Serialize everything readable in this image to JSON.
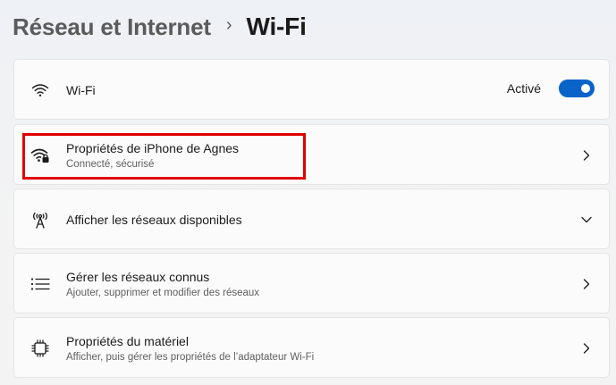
{
  "breadcrumb": {
    "parent": "Réseau et Internet",
    "separator": "›",
    "current": "Wi-Fi"
  },
  "wifi_toggle": {
    "label": "Wi-Fi",
    "state_text": "Activé",
    "on": true,
    "icon": "wifi-icon"
  },
  "items": [
    {
      "label": "Propriétés de iPhone de Agnes",
      "sub": "Connecté, sécurisé",
      "icon": "wifi-secured-icon",
      "action": "chevron-right-icon"
    },
    {
      "label": "Afficher les réseaux disponibles",
      "icon": "antenna-icon",
      "action": "chevron-down-icon"
    },
    {
      "label": "Gérer les réseaux connus",
      "sub": "Ajouter, supprimer et modifier des réseaux",
      "icon": "list-icon",
      "action": "chevron-right-icon"
    },
    {
      "label": "Propriétés du matériel",
      "sub": "Afficher, puis gérer les propriétés de l’adaptateur Wi-Fi",
      "icon": "chip-icon",
      "action": "chevron-right-icon"
    }
  ],
  "colors": {
    "accent": "#0a63c9",
    "highlight": "#e00000",
    "card": "#fbfbfb",
    "background": "#f3f3f3"
  }
}
